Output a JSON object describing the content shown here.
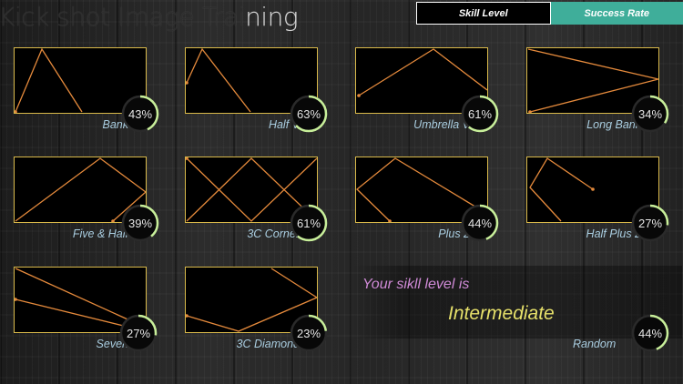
{
  "app": {
    "title_dim": "Kick shot Image Trai",
    "title_bright": "ning"
  },
  "tabs": [
    {
      "label": "Skill Level",
      "active": true
    },
    {
      "label": "Success Rate",
      "active": false
    }
  ],
  "shots": [
    {
      "name": "Bank",
      "percent": 43,
      "percent_label": "43%"
    },
    {
      "name": "Half V",
      "percent": 63,
      "percent_label": "63%"
    },
    {
      "name": "Umbrella V",
      "percent": 61,
      "percent_label": "61%"
    },
    {
      "name": "Long Bank",
      "percent": 34,
      "percent_label": "34%"
    },
    {
      "name": "Five & Half",
      "percent": 39,
      "percent_label": "39%"
    },
    {
      "name": "3C Corner",
      "percent": 61,
      "percent_label": "61%"
    },
    {
      "name": "Plus 2",
      "percent": 44,
      "percent_label": "44%"
    },
    {
      "name": "Half Plus 2",
      "percent": 27,
      "percent_label": "27%"
    },
    {
      "name": "Seven",
      "percent": 27,
      "percent_label": "27%"
    },
    {
      "name": "3C Diamond",
      "percent": 23,
      "percent_label": "23%"
    }
  ],
  "skill": {
    "prompt": "Your sikll level is",
    "level": "Intermediate"
  },
  "random": {
    "name": "Random",
    "percent": 44,
    "percent_label": "44%"
  },
  "colors": {
    "table_border": "#d9b94a",
    "shot_line": "#e58a3c",
    "ring_progress": "#c8ef9a",
    "ring_track": "#2a2a2a",
    "tab_active_bg": "#000000",
    "tab_inactive_bg": "#3fae9a",
    "label_text": "#a9cde0",
    "skill_prompt": "#cf8ad6",
    "skill_level": "#e6e06a"
  }
}
